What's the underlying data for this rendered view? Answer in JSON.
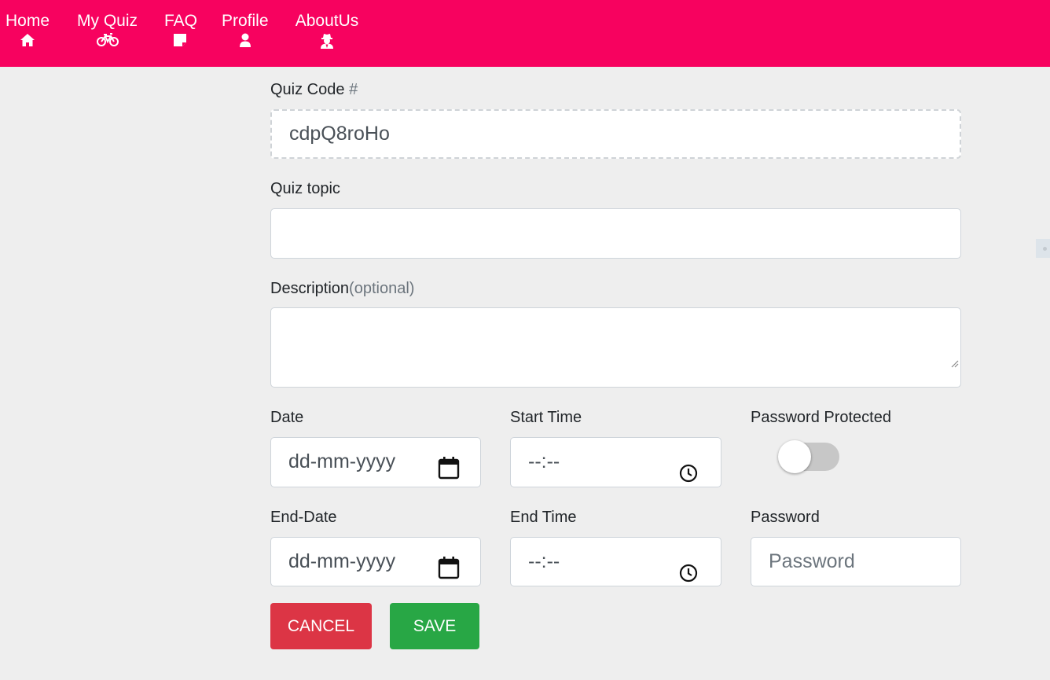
{
  "nav": {
    "items": [
      {
        "label": "Home",
        "icon": "home-icon"
      },
      {
        "label": "My Quiz",
        "icon": "bicycle-icon"
      },
      {
        "label": "FAQ",
        "icon": "sticky-note-icon"
      },
      {
        "label": "Profile",
        "icon": "user-icon"
      },
      {
        "label": "AboutUs",
        "icon": "user-secret-icon"
      }
    ]
  },
  "form": {
    "quiz_code_label": "Quiz Code",
    "quiz_code_hash": "#",
    "quiz_code_value": "cdpQ8roHo",
    "quiz_topic_label": "Quiz topic",
    "quiz_topic_value": "",
    "description_label": "Description",
    "description_optional": "(optional)",
    "description_value": "",
    "date_label": "Date",
    "date_value": "dd-mm-yyyy",
    "start_time_label": "Start Time",
    "start_time_value": "--:--",
    "password_protected_label": "Password Protected",
    "password_protected_on": false,
    "end_date_label": "End-Date",
    "end_date_value": "dd-mm-yyyy",
    "end_time_label": "End Time",
    "end_time_value": "--:--",
    "password_label": "Password",
    "password_placeholder": "Password",
    "cancel_label": "CANCEL",
    "save_label": "SAVE"
  },
  "colors": {
    "navbar": "#f7025f",
    "page_background": "#eeeeee",
    "cancel_button": "#dc3545",
    "save_button": "#28a745",
    "toggle_track_off": "#c7c7c7"
  }
}
